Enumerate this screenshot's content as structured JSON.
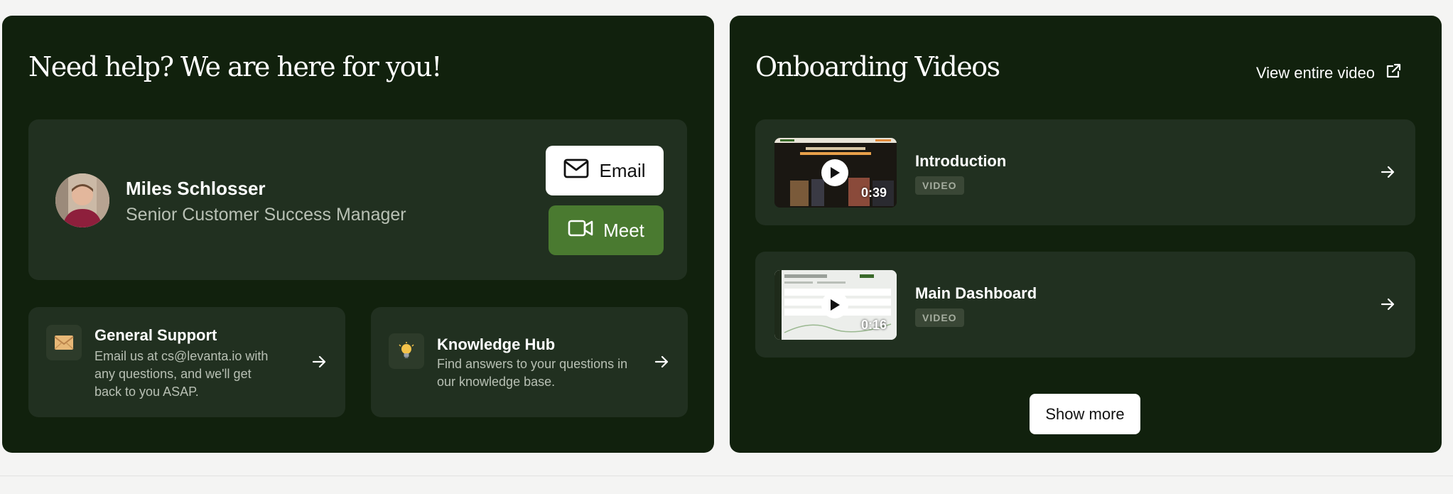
{
  "help": {
    "title": "Need help? We are here for you!",
    "contact": {
      "name": "Miles Schlosser",
      "role": "Senior Customer Success Manager",
      "email_label": "Email",
      "meet_label": "Meet"
    },
    "general_support": {
      "title": "General Support",
      "description": "Email us at cs@levanta.io with any questions, and we'll get back to you ASAP.",
      "icon": "envelope-icon"
    },
    "knowledge_hub": {
      "title": "Knowledge Hub",
      "description": "Find answers to your questions in our knowledge base.",
      "icon": "lightbulb-icon"
    }
  },
  "videos": {
    "title": "Onboarding Videos",
    "view_entire_label": "View entire video",
    "items": [
      {
        "title": "Introduction",
        "badge": "VIDEO",
        "duration": "0:39"
      },
      {
        "title": "Main Dashboard",
        "badge": "VIDEO",
        "duration": "0:16"
      }
    ],
    "show_more_label": "Show more"
  },
  "colors": {
    "panel_bg": "#11210d",
    "card_bg": "#213020",
    "meet_button": "#4a7a30",
    "page_bg": "#f4f4f3"
  }
}
